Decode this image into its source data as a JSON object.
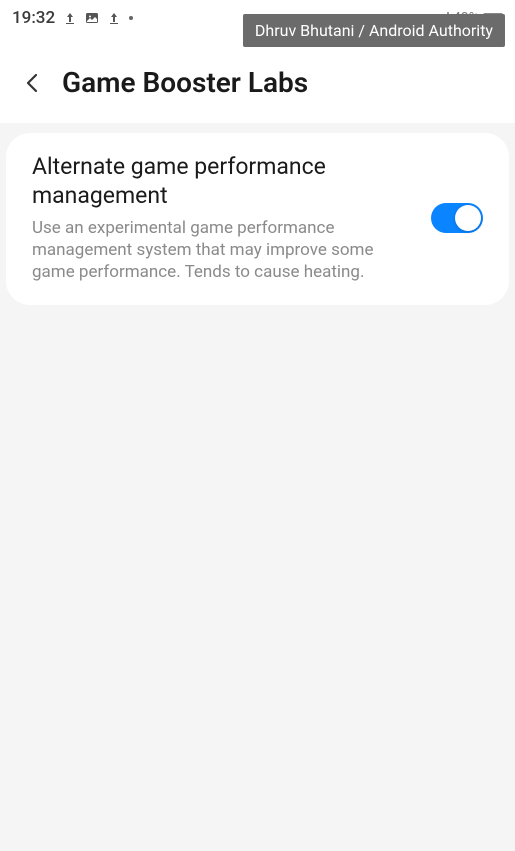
{
  "status_bar": {
    "time": "19:32",
    "battery_percent": "49%"
  },
  "watermark": "Dhruv Bhutani / Android Authority",
  "header": {
    "title": "Game Booster Labs"
  },
  "settings": {
    "alternate_perf": {
      "title": "Alternate game performance management",
      "description": "Use an experimental game performance management system that may improve some game performance. Tends to cause heating.",
      "enabled": true
    }
  }
}
